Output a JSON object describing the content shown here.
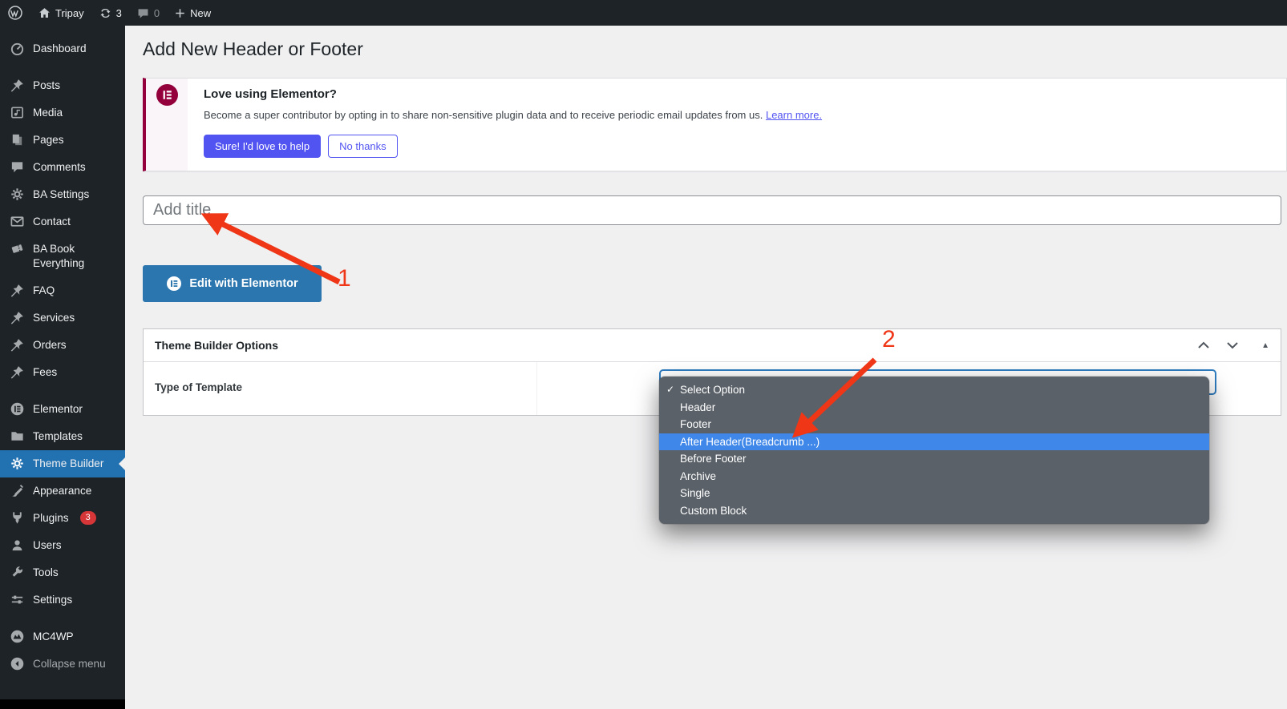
{
  "admin_bar": {
    "site_name": "Tripay",
    "updates_count": "3",
    "comments_count": "0",
    "new_label": "New"
  },
  "sidebar": {
    "items": [
      {
        "label": "Dashboard",
        "icon": "dashboard",
        "gap_after": true
      },
      {
        "label": "Posts",
        "icon": "pin"
      },
      {
        "label": "Media",
        "icon": "media"
      },
      {
        "label": "Pages",
        "icon": "pages"
      },
      {
        "label": "Comments",
        "icon": "comment"
      },
      {
        "label": "BA Settings",
        "icon": "gear"
      },
      {
        "label": "Contact",
        "icon": "mail"
      },
      {
        "label": "BA Book Everything",
        "icon": "ticket"
      },
      {
        "label": "FAQ",
        "icon": "pin"
      },
      {
        "label": "Services",
        "icon": "pin"
      },
      {
        "label": "Orders",
        "icon": "pin"
      },
      {
        "label": "Fees",
        "icon": "pin",
        "gap_after": true
      },
      {
        "label": "Elementor",
        "icon": "elementor"
      },
      {
        "label": "Templates",
        "icon": "folder"
      },
      {
        "label": "Theme Builder",
        "icon": "gear",
        "active": true
      },
      {
        "label": "Appearance",
        "icon": "brush"
      },
      {
        "label": "Plugins",
        "icon": "plug",
        "badge": "3"
      },
      {
        "label": "Users",
        "icon": "user"
      },
      {
        "label": "Tools",
        "icon": "wrench"
      },
      {
        "label": "Settings",
        "icon": "sliders",
        "gap_after": true
      },
      {
        "label": "MC4WP",
        "icon": "mc4wp"
      },
      {
        "label": "Collapse menu",
        "icon": "collapse",
        "dim": true
      }
    ]
  },
  "page": {
    "title": "Add New Header or Footer"
  },
  "notice": {
    "heading": "Love using Elementor?",
    "body": "Become a super contributor by opting in to share non-sensitive plugin data and to receive periodic email updates from us.",
    "link_label": "Learn more.",
    "accept_label": "Sure! I'd love to help",
    "decline_label": "No thanks"
  },
  "editor": {
    "title_placeholder": "Add title",
    "edit_button_label": "Edit with Elementor"
  },
  "theme_builder": {
    "panel_title": "Theme Builder Options",
    "field_label": "Type of Template"
  },
  "dropdown": {
    "options": [
      {
        "label": "Select Option",
        "checked": true
      },
      {
        "label": "Header"
      },
      {
        "label": "Footer"
      },
      {
        "label": "After Header(Breadcrumb ...)",
        "highlighted": true
      },
      {
        "label": "Before Footer"
      },
      {
        "label": "Archive"
      },
      {
        "label": "Single"
      },
      {
        "label": "Custom Block"
      }
    ]
  },
  "annotations": {
    "step1": "1",
    "step2": "2"
  },
  "colors": {
    "menubg": "#1d2327",
    "accent": "#2271b1",
    "maroon": "#93003c",
    "indigo": "#5254f1",
    "red": "#ef3617",
    "hl": "#3f87e8",
    "badge": "#d63638",
    "elbtn": "#2b76ae"
  }
}
